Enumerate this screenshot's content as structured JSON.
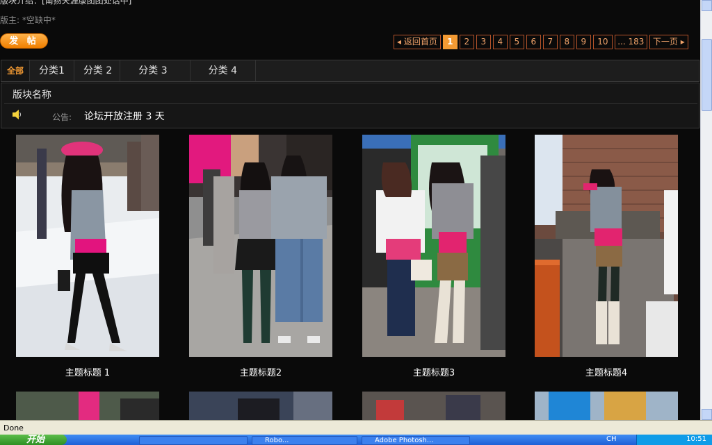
{
  "forum": {
    "topline": "版块介绍：[南扬天涯康团团处话中]",
    "moderator": "版主: *空缺中*",
    "post_button": "发 帖"
  },
  "pager": {
    "back_home": "返回首页",
    "pages": [
      "1",
      "2",
      "3",
      "4",
      "5",
      "6",
      "7",
      "8",
      "9",
      "10"
    ],
    "current": "1",
    "ellipsis_last": "... 183",
    "next": "下一页"
  },
  "categories": [
    "全部",
    "分类1",
    "分类 2",
    "分类 3",
    "分类 4"
  ],
  "board": {
    "title": "版块名称",
    "notice_label": "公告:",
    "notice_text": "论坛开放注册 3 天"
  },
  "topics": [
    {
      "title": "主题标题 1",
      "thumbnail": "photo-street-girl-pink-cap"
    },
    {
      "title": "主题标题2",
      "thumbnail": "photo-two-girls-back"
    },
    {
      "title": "主题标题3",
      "thumbnail": "photo-girls-at-vending"
    },
    {
      "title": "主题标题4",
      "thumbnail": "photo-girl-by-brick-wall"
    }
  ],
  "status": {
    "text": "Done"
  },
  "taskbar": {
    "start": "开始",
    "tasks": [
      "",
      "Robo...",
      "Adobe Photosh..."
    ],
    "ime": "CH",
    "clock": "10:51"
  },
  "colors": {
    "accent": "#f39a33",
    "pager_border": "#b7542a",
    "background": "#0a0a0a"
  }
}
